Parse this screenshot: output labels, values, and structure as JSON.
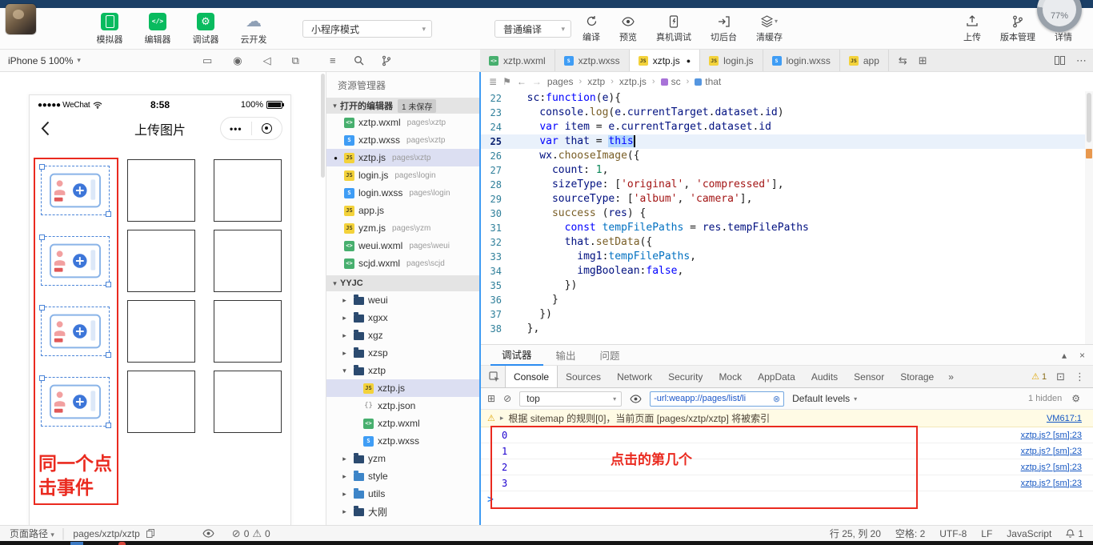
{
  "window": {
    "gauge": "77%"
  },
  "toolbar": {
    "apps": [
      {
        "id": "simulator",
        "label": "模拟器"
      },
      {
        "id": "editor",
        "label": "编辑器"
      },
      {
        "id": "debugger",
        "label": "调试器"
      },
      {
        "id": "cloud",
        "label": "云开发"
      }
    ],
    "mode_select": "小程序模式",
    "compile_select": "普通编译",
    "actions": [
      {
        "id": "compile",
        "label": "编译"
      },
      {
        "id": "preview",
        "label": "预览"
      },
      {
        "id": "real-device",
        "label": "真机调试"
      },
      {
        "id": "background",
        "label": "切后台"
      },
      {
        "id": "clear-cache",
        "label": "清缓存",
        "caret": true
      }
    ],
    "right_actions": [
      {
        "id": "upload",
        "label": "上传"
      },
      {
        "id": "version",
        "label": "版本管理"
      },
      {
        "id": "detail",
        "label": "详情"
      }
    ]
  },
  "subbar": {
    "device": "iPhone 5 100%",
    "sim_icons": [
      "device-icon",
      "record-icon",
      "sound-icon",
      "float-window-icon"
    ],
    "explorer_icons": [
      "collapse-explorer-icon",
      "search-icon",
      "scm-icon"
    ],
    "tabs": [
      {
        "label": "xztp.wxml",
        "type": "wxml"
      },
      {
        "label": "xztp.wxss",
        "type": "wxss"
      },
      {
        "label": "xztp.js",
        "type": "js",
        "active": true,
        "dirty": true
      },
      {
        "label": "login.js",
        "type": "js"
      },
      {
        "label": "login.wxss",
        "type": "wxss"
      },
      {
        "label": "app",
        "type": "js"
      }
    ]
  },
  "simulator": {
    "carrier": "●●●●● WeChat",
    "time": "8:58",
    "battery": "100%",
    "nav_title": "上传图片",
    "capsule_dots": "•••",
    "grid": {
      "rows": 4,
      "cols": 3,
      "card_col": 0
    },
    "annotation": {
      "lines": [
        "同一个点",
        "击事件"
      ]
    }
  },
  "explorer": {
    "title": "资源管理器",
    "open_editors": {
      "label": "打开的编辑器",
      "badge": "1 未保存"
    },
    "open_files": [
      {
        "name": "xztp.wxml",
        "path": "pages\\xztp",
        "type": "wxml"
      },
      {
        "name": "xztp.wxss",
        "path": "pages\\xztp",
        "type": "wxss"
      },
      {
        "name": "xztp.js",
        "path": "pages\\xztp",
        "type": "js",
        "active": true,
        "dirty": true
      },
      {
        "name": "login.js",
        "path": "pages\\login",
        "type": "js"
      },
      {
        "name": "login.wxss",
        "path": "pages\\login",
        "type": "wxss"
      },
      {
        "name": "app.js",
        "path": "",
        "type": "js"
      },
      {
        "name": "yzm.js",
        "path": "pages\\yzm",
        "type": "js"
      },
      {
        "name": "weui.wxml",
        "path": "pages\\weui",
        "type": "wxml"
      },
      {
        "name": "scjd.wxml",
        "path": "pages\\scjd",
        "type": "wxml"
      }
    ],
    "project": "YYJC",
    "tree": [
      {
        "name": "weui",
        "kind": "folder"
      },
      {
        "name": "xgxx",
        "kind": "folder"
      },
      {
        "name": "xgz",
        "kind": "folder"
      },
      {
        "name": "xzsp",
        "kind": "folder"
      },
      {
        "name": "xztp",
        "kind": "folder",
        "expanded": true
      },
      {
        "name": "xztp.js",
        "kind": "file",
        "type": "js",
        "nested": true,
        "selected": true
      },
      {
        "name": "xztp.json",
        "kind": "file",
        "type": "json",
        "nested": true
      },
      {
        "name": "xztp.wxml",
        "kind": "file",
        "type": "wxml",
        "nested": true
      },
      {
        "name": "xztp.wxss",
        "kind": "file",
        "type": "wxss",
        "nested": true
      },
      {
        "name": "yzm",
        "kind": "folder"
      },
      {
        "name": "style",
        "kind": "folder",
        "accent": true
      },
      {
        "name": "utils",
        "kind": "folder",
        "accent": true
      },
      {
        "name": "大刚",
        "kind": "folder"
      }
    ]
  },
  "editor": {
    "breadcrumb": [
      {
        "label": "pages"
      },
      {
        "label": "xztp"
      },
      {
        "label": "xztp.js"
      },
      {
        "label": "sc",
        "symbol": "method"
      },
      {
        "label": "that",
        "symbol": "variable"
      }
    ],
    "current_line": 25,
    "lines": [
      {
        "n": 22,
        "seg": [
          [
            "  sc",
            "id"
          ],
          [
            ":",
            "p"
          ],
          [
            "function",
            "kw"
          ],
          [
            "(",
            "p"
          ],
          [
            "e",
            "id"
          ],
          [
            "){",
            "p"
          ]
        ]
      },
      {
        "n": 23,
        "seg": [
          [
            "    console",
            "id"
          ],
          [
            ".",
            "p"
          ],
          [
            "log",
            "fn"
          ],
          [
            "(",
            "p"
          ],
          [
            "e",
            "id"
          ],
          [
            ".",
            "p"
          ],
          [
            "currentTarget",
            "id"
          ],
          [
            ".",
            "p"
          ],
          [
            "dataset",
            "id"
          ],
          [
            ".",
            "p"
          ],
          [
            "id",
            "id"
          ],
          [
            ")",
            "p"
          ]
        ]
      },
      {
        "n": 24,
        "seg": [
          [
            "    ",
            "p"
          ],
          [
            "var",
            "kw"
          ],
          [
            " ",
            "p"
          ],
          [
            "item",
            "id"
          ],
          [
            " = ",
            "p"
          ],
          [
            "e",
            "id"
          ],
          [
            ".",
            "p"
          ],
          [
            "currentTarget",
            "id"
          ],
          [
            ".",
            "p"
          ],
          [
            "dataset",
            "id"
          ],
          [
            ".",
            "p"
          ],
          [
            "id",
            "id"
          ]
        ]
      },
      {
        "n": 25,
        "seg": [
          [
            "    ",
            "p"
          ],
          [
            "var",
            "kw"
          ],
          [
            " ",
            "p"
          ],
          [
            "that",
            "id"
          ],
          [
            " = ",
            "p"
          ],
          [
            "this",
            "kw sel"
          ],
          [
            "",
            "caret"
          ]
        ]
      },
      {
        "n": 26,
        "seg": [
          [
            "    wx",
            "id"
          ],
          [
            ".",
            "p"
          ],
          [
            "chooseImage",
            "fn"
          ],
          [
            "({",
            "p"
          ]
        ]
      },
      {
        "n": 27,
        "seg": [
          [
            "      count",
            "key"
          ],
          [
            ": ",
            "p"
          ],
          [
            "1",
            "num"
          ],
          [
            ",",
            "p"
          ]
        ]
      },
      {
        "n": 28,
        "seg": [
          [
            "      sizeType",
            "key"
          ],
          [
            ": [",
            "p"
          ],
          [
            "'original'",
            "str"
          ],
          [
            ", ",
            "p"
          ],
          [
            "'compressed'",
            "str"
          ],
          [
            "],",
            "p"
          ]
        ]
      },
      {
        "n": 29,
        "seg": [
          [
            "      sourceType",
            "key"
          ],
          [
            ": [",
            "p"
          ],
          [
            "'album'",
            "str"
          ],
          [
            ", ",
            "p"
          ],
          [
            "'camera'",
            "str"
          ],
          [
            "],",
            "p"
          ]
        ]
      },
      {
        "n": 30,
        "seg": [
          [
            "      success",
            "fn"
          ],
          [
            " (",
            "p"
          ],
          [
            "res",
            "id"
          ],
          [
            ") {",
            "p"
          ]
        ]
      },
      {
        "n": 31,
        "seg": [
          [
            "        ",
            "p"
          ],
          [
            "const",
            "kw"
          ],
          [
            " ",
            "p"
          ],
          [
            "tempFilePaths",
            "cb"
          ],
          [
            " = ",
            "p"
          ],
          [
            "res",
            "id"
          ],
          [
            ".",
            "p"
          ],
          [
            "tempFilePaths",
            "id"
          ]
        ]
      },
      {
        "n": 32,
        "seg": [
          [
            "        that",
            "id"
          ],
          [
            ".",
            "p"
          ],
          [
            "setData",
            "fn"
          ],
          [
            "({",
            "p"
          ]
        ]
      },
      {
        "n": 33,
        "seg": [
          [
            "          img1",
            "key"
          ],
          [
            ":",
            "p"
          ],
          [
            "tempFilePaths",
            "cb"
          ],
          [
            ",",
            "p"
          ]
        ]
      },
      {
        "n": 34,
        "seg": [
          [
            "          imgBoolean",
            "key"
          ],
          [
            ":",
            "p"
          ],
          [
            "false",
            "kw"
          ],
          [
            ",",
            "p"
          ]
        ]
      },
      {
        "n": 35,
        "seg": [
          [
            "        })",
            "p"
          ]
        ]
      },
      {
        "n": 36,
        "seg": [
          [
            "      }",
            "p"
          ]
        ]
      },
      {
        "n": 37,
        "seg": [
          [
            "    })",
            "p"
          ]
        ]
      },
      {
        "n": 38,
        "seg": [
          [
            "  },",
            "p"
          ]
        ]
      }
    ]
  },
  "debug": {
    "panel_tabs": [
      {
        "label": "调试器",
        "active": true
      },
      {
        "label": "输出"
      },
      {
        "label": "问题"
      }
    ],
    "devtools_tabs": [
      {
        "label": "Console",
        "active": true
      },
      {
        "label": "Sources"
      },
      {
        "label": "Network"
      },
      {
        "label": "Security"
      },
      {
        "label": "Mock"
      },
      {
        "label": "AppData"
      },
      {
        "label": "Audits"
      },
      {
        "label": "Sensor"
      },
      {
        "label": "Storage"
      }
    ],
    "overflow": "»",
    "warn_count": "1",
    "context": "top",
    "filter_value": "-url:weapp://pages/list/li",
    "levels": "Default levels",
    "hidden_count": "1 hidden",
    "warning": {
      "text": "根据 sitemap 的规则[0]，当前页面 [pages/xztp/xztp] 将被索引",
      "link": "VM617:1"
    },
    "logs": [
      {
        "value": "0",
        "link": "xztp.js? [sm]:23"
      },
      {
        "value": "1",
        "link": "xztp.js? [sm]:23"
      },
      {
        "value": "2",
        "link": "xztp.js? [sm]:23"
      },
      {
        "value": "3",
        "link": "xztp.js? [sm]:23"
      }
    ],
    "annotation": "点击的第几个"
  },
  "statusbar": {
    "path_label": "页面路径",
    "page_path": "pages/xztp/xztp",
    "errors": "0",
    "warnings": "0",
    "cursor": "行 25, 列 20",
    "spaces": "空格: 2",
    "encoding": "UTF-8",
    "eol": "LF",
    "language": "JavaScript",
    "bell_count": "1"
  },
  "colors": {
    "accent_green": "#09bb5f",
    "accent_blue": "#2d8cf0",
    "annotation_red": "#ea2a1f",
    "selection_blue": "#b3d7fd"
  }
}
